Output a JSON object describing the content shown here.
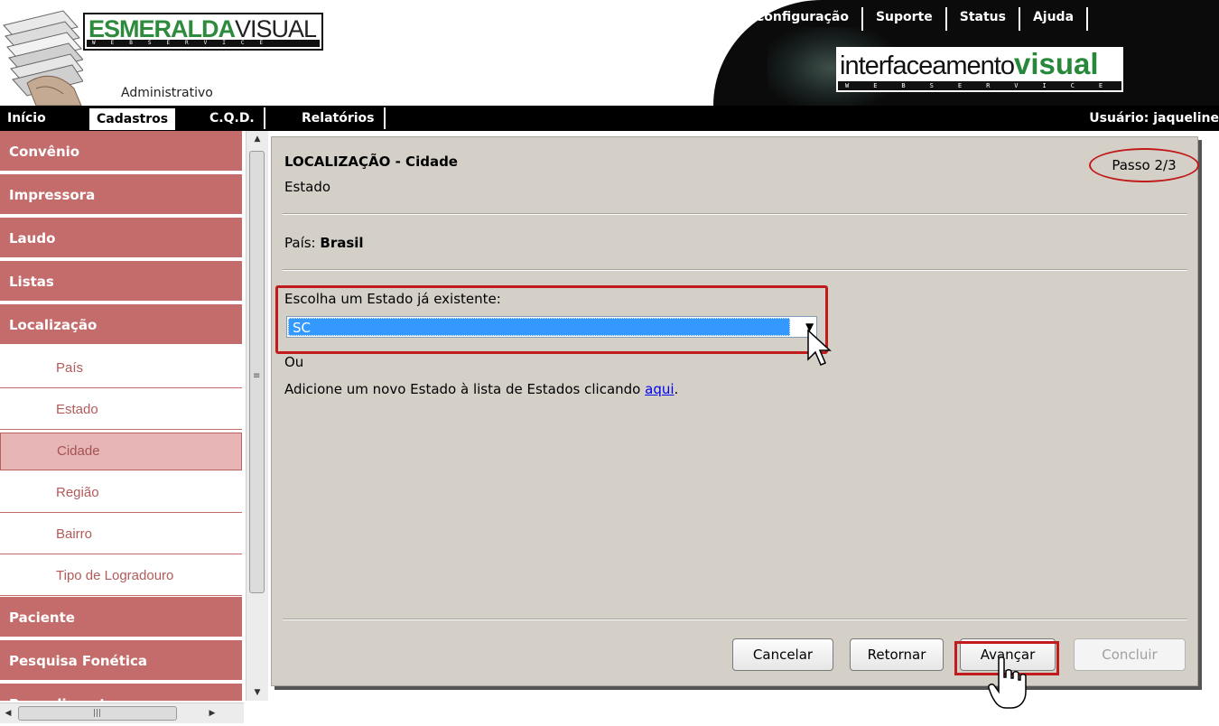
{
  "header": {
    "brand_left": {
      "bold": "ESMERALDA",
      "regular": "VISUAL",
      "strip": "WEBSERVICE"
    },
    "module": "Administrativo",
    "top_nav": [
      "Configuração",
      "Suporte",
      "Status",
      "Ajuda"
    ],
    "brand_right": {
      "regular": "interfaceamento",
      "bold": "visual",
      "strip": "WEBSERVICE"
    }
  },
  "menubar": {
    "items": [
      "Início",
      "Cadastros",
      "C.Q.D.",
      "Relatórios"
    ],
    "active": "Cadastros",
    "user": "Usuário: jaqueline"
  },
  "sidebar": {
    "categories_top": [
      "Convênio",
      "Impressora",
      "Laudo",
      "Listas",
      "Localização"
    ],
    "subitems": [
      "País",
      "Estado",
      "Cidade",
      "Região",
      "Bairro",
      "Tipo de Logradouro"
    ],
    "active_subitem": "Cidade",
    "categories_bottom": [
      "Paciente",
      "Pesquisa Fonética",
      "Procedimento"
    ]
  },
  "content": {
    "title": "LOCALIZAÇÃO - Cidade",
    "subtitle": "Estado",
    "step": "Passo 2/3",
    "country_label": "País:",
    "country_value": "Brasil",
    "state_label": "Escolha um Estado já existente:",
    "state_selected": "SC",
    "or_label": "Ou",
    "add_text": "Adicione um novo Estado à lista de Estados clicando",
    "add_link": "aqui",
    "add_suffix": ".",
    "buttons": {
      "cancel": "Cancelar",
      "back": "Retornar",
      "next": "Avançar",
      "finish": "Concluir"
    }
  },
  "colors": {
    "sidebar_category": "#c46b6b",
    "sidebar_active": "#e7b5b5",
    "content_bg": "#d4d0c8",
    "highlight": "#c21b1b",
    "select_highlight": "#3399ff"
  }
}
